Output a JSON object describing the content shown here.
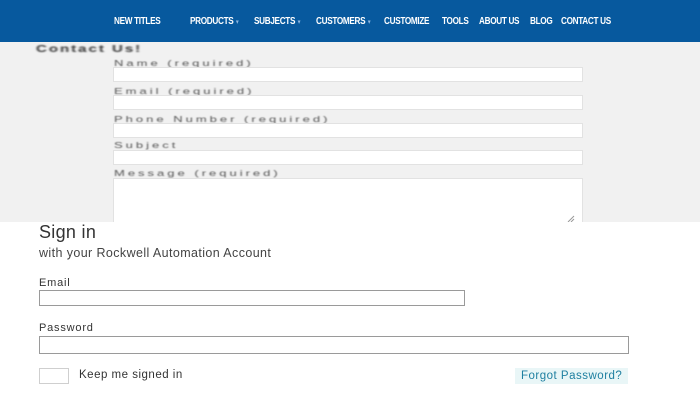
{
  "nav": {
    "items": [
      {
        "label": "NEW TITLES"
      },
      {
        "label": "PRODUCTS"
      },
      {
        "label": "SUBJECTS"
      },
      {
        "label": "CUSTOMERS"
      },
      {
        "label": "CUSTOMIZE"
      },
      {
        "label": "TOOLS"
      },
      {
        "label": "ABOUT US"
      },
      {
        "label": "BLOG"
      },
      {
        "label": "CONTACT US"
      }
    ],
    "chevron": "▾",
    "background_color": "#07599e"
  },
  "contact_form": {
    "title": "Contact Us!",
    "fields": {
      "name_label": "Name (required)",
      "email_label": "Email (required)",
      "phone_label": "Phone Number (required)",
      "subject_label": "Subject",
      "message_label": "Message (required)"
    }
  },
  "signin": {
    "title": "Sign in",
    "subtitle": "with your Rockwell Automation Account",
    "email_label": "Email",
    "email_value": "",
    "password_label": "Password",
    "password_value": "",
    "keep_signed_in_label": "Keep me signed in",
    "forgot_password_label": "Forgot Password?",
    "link_color": "#1e7fa0"
  }
}
